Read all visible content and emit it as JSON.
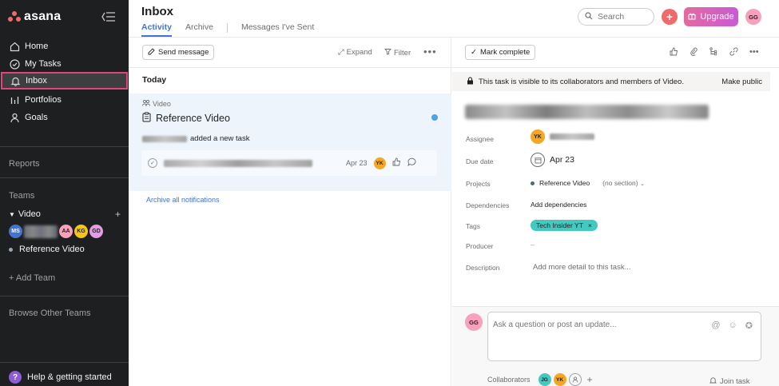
{
  "app": {
    "logo_text": "asana"
  },
  "sidebar": {
    "nav": [
      {
        "label": "Home",
        "icon": "home-icon"
      },
      {
        "label": "My Tasks",
        "icon": "check-circle-icon"
      },
      {
        "label": "Inbox",
        "icon": "bell-icon"
      },
      {
        "label": "Portfolios",
        "icon": "bar-chart-icon"
      },
      {
        "label": "Goals",
        "icon": "person-icon"
      }
    ],
    "reports_label": "Reports",
    "teams_label": "Teams",
    "team": {
      "name": "Video",
      "members": [
        "MS",
        "AA",
        "KG",
        "GD"
      ]
    },
    "project": "Reference Video",
    "add_team": "+ Add Team",
    "browse_teams": "Browse Other Teams",
    "help": "Help & getting started"
  },
  "header": {
    "title": "Inbox",
    "tabs": [
      "Activity",
      "Archive",
      "Messages I've Sent"
    ],
    "search_placeholder": "Search",
    "upgrade_label": "Upgrade",
    "user_initials": "GG"
  },
  "inbox": {
    "send_message": "Send message",
    "expand": "Expand",
    "filter": "Filter",
    "section": "Today",
    "notification": {
      "project": "Video",
      "title": "Reference Video",
      "action": "added a new task",
      "task_date": "Apr 23",
      "assignee_initials": "YK"
    },
    "archive_all": "Archive all notifications"
  },
  "detail": {
    "mark_complete": "Mark complete",
    "visibility_text": "This task is visible to its collaborators and members of Video.",
    "make_public": "Make public",
    "fields": {
      "assignee_label": "Assignee",
      "assignee_initials": "YK",
      "due_label": "Due date",
      "due_value": "Apr 23",
      "projects_label": "Projects",
      "project_value": "Reference Video",
      "section_value": "(no section)",
      "dependencies_label": "Dependencies",
      "dependencies_value": "Add dependencies",
      "tags_label": "Tags",
      "tag_value": "Tech Insider YT",
      "producer_label": "Producer",
      "producer_value": "–",
      "description_label": "Description",
      "description_placeholder": "Add more detail to this task..."
    },
    "comment_placeholder": "Ask a question or post an update...",
    "commenter_initials": "GG",
    "collaborators_label": "Collaborators",
    "collaborators": [
      "JG",
      "YK"
    ],
    "join_task": "Join task"
  },
  "colors": {
    "sidebar_bg": "#1e1f21",
    "accent_blue": "#4573d2",
    "brand_coral": "#f06a6a",
    "tag_teal": "#43c9c0"
  }
}
